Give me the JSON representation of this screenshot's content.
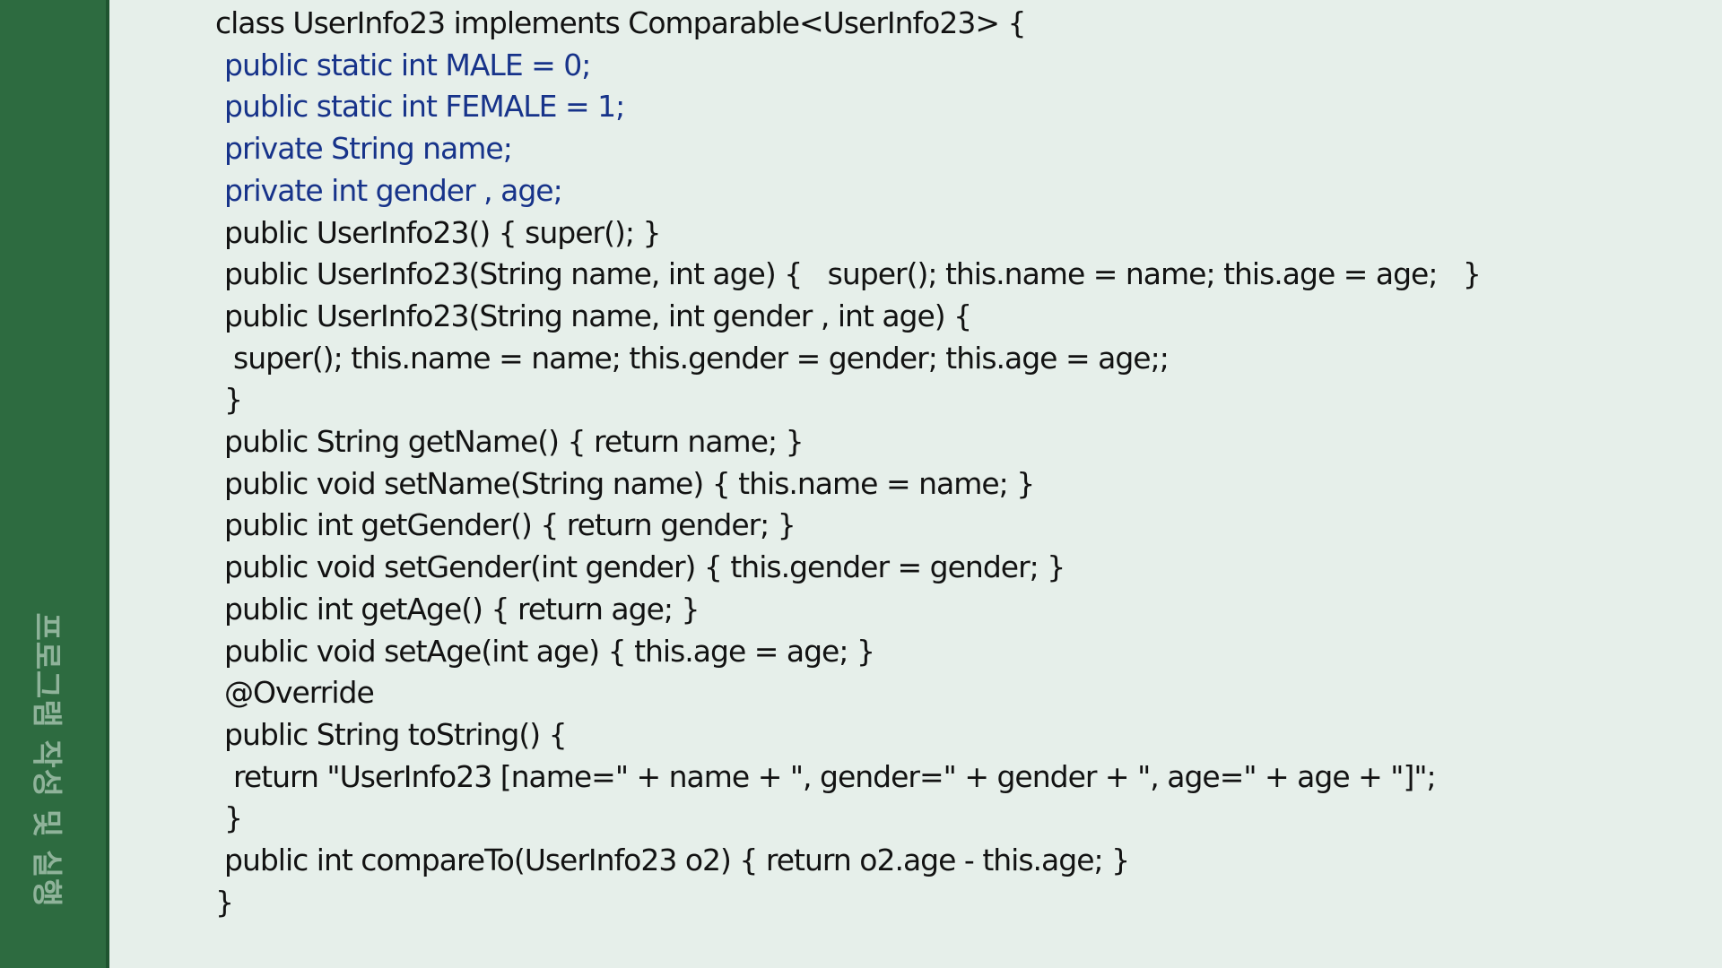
{
  "sidebar": {
    "title": "프로그램 작성 및 실행"
  },
  "colors": {
    "background": "#e6efea",
    "sidebar": "#2d6b40",
    "sidebar_text": "#8fb39a",
    "code_text": "#121212",
    "field_text": "#17338a"
  },
  "code_lines": [
    {
      "text": "class UserInfo23 implements Comparable<UserInfo23> {",
      "kind": "plain",
      "indent": 0
    },
    {
      "text": "public static int MALE = 0;",
      "kind": "field",
      "indent": 1
    },
    {
      "text": "public static int FEMALE = 1;",
      "kind": "field",
      "indent": 1
    },
    {
      "text": "private String name;",
      "kind": "field",
      "indent": 1
    },
    {
      "text": "private int gender , age;",
      "kind": "field",
      "indent": 1
    },
    {
      "text": "public UserInfo23() { super(); }",
      "kind": "plain",
      "indent": 1
    },
    {
      "text": "public UserInfo23(String name, int age) {   super(); this.name = name; this.age = age;   }",
      "kind": "plain",
      "indent": 1
    },
    {
      "text": "public UserInfo23(String name, int gender , int age) {",
      "kind": "plain",
      "indent": 1
    },
    {
      "text": "super(); this.name = name; this.gender = gender; this.age = age;;",
      "kind": "plain",
      "indent": 2
    },
    {
      "text": "}",
      "kind": "plain",
      "indent": 1
    },
    {
      "text": "public String getName() { return name; }",
      "kind": "plain",
      "indent": 1
    },
    {
      "text": "public void setName(String name) { this.name = name; }",
      "kind": "plain",
      "indent": 1
    },
    {
      "text": "public int getGender() { return gender; }",
      "kind": "plain",
      "indent": 1
    },
    {
      "text": "public void setGender(int gender) { this.gender = gender; }",
      "kind": "plain",
      "indent": 1
    },
    {
      "text": "public int getAge() { return age; }",
      "kind": "plain",
      "indent": 1
    },
    {
      "text": "public void setAge(int age) { this.age = age; }",
      "kind": "plain",
      "indent": 1
    },
    {
      "text": "@Override",
      "kind": "plain",
      "indent": 1
    },
    {
      "text": "public String toString() {",
      "kind": "plain",
      "indent": 1
    },
    {
      "text": "return \"UserInfo23 [name=\" + name + \", gender=\" + gender + \", age=\" + age + \"]\";",
      "kind": "plain",
      "indent": 2
    },
    {
      "text": "}",
      "kind": "plain",
      "indent": 1
    },
    {
      "text": "public int compareTo(UserInfo23 o2) { return o2.age - this.age; }",
      "kind": "plain",
      "indent": 1
    },
    {
      "text": "}",
      "kind": "plain",
      "indent": 0
    }
  ]
}
